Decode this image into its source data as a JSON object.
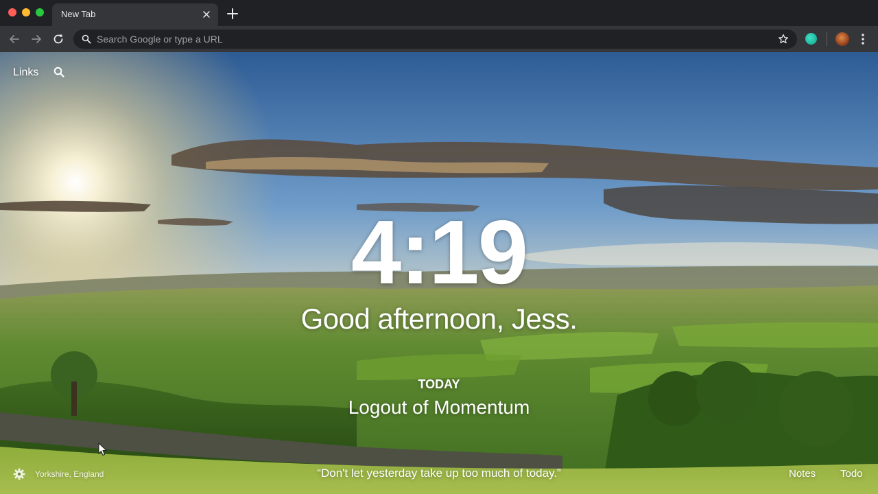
{
  "browser": {
    "tab_title": "New Tab",
    "omnibox_placeholder": "Search Google or type a URL"
  },
  "icons": {
    "back": "arrow-left-icon",
    "forward": "arrow-right-icon",
    "reload": "reload-icon",
    "search": "search-icon",
    "bookmark": "star-icon",
    "extension": "extension-icon",
    "profile": "avatar",
    "menu": "menu-dots-icon",
    "settings": "gear-icon"
  },
  "momentum": {
    "links_label": "Links",
    "time": "4:19",
    "greeting": "Good afternoon, Jess.",
    "focus": {
      "label": "TODAY",
      "item": "Logout of Momentum"
    },
    "location": "Yorkshire, England",
    "quote": "“Don't let yesterday take up too much of today.”",
    "notes_label": "Notes",
    "todo_label": "Todo"
  },
  "colors": {
    "chrome_dark": "#202124",
    "toolbar": "#35363a",
    "text_light": "#e8eaed",
    "placeholder": "#9aa0a6",
    "extension_teal": "#2ccfb1"
  }
}
